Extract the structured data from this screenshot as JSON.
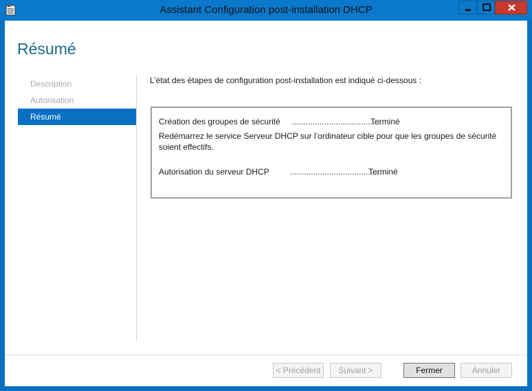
{
  "window": {
    "title": "Assistant Configuration post-installation DHCP"
  },
  "heading": "Résumé",
  "nav": {
    "items": [
      {
        "label": "Description",
        "active": false
      },
      {
        "label": "Autorisation",
        "active": false
      },
      {
        "label": "Résumé",
        "active": true
      }
    ]
  },
  "intro": "L’état des étapes de configuration post-installation est indiqué ci-dessous :",
  "steps": [
    {
      "label": "Création des groupes de sécurité",
      "dots": ".......................................",
      "status": "Terminé"
    },
    {
      "label": "Autorisation du serveur DHCP",
      "dots": ".......................................",
      "status": "Terminé"
    }
  ],
  "note": "Redémarrez le service Serveur DHCP sur l’ordinateur cible pour que les groupes de sécurité soient effectifs.",
  "buttons": {
    "previous": "< Précédent",
    "next": "Suivant >",
    "close": "Fermer",
    "cancel": "Annuler"
  },
  "colors": {
    "titlebar": "#0a79cc",
    "accent": "#0b6fc4",
    "close_button": "#c7392d",
    "heading": "#1a6a8c"
  },
  "icons": {
    "app": "dhcp-wizard-icon",
    "minimize": "minimize-icon",
    "maximize": "maximize-icon",
    "close": "close-icon"
  }
}
